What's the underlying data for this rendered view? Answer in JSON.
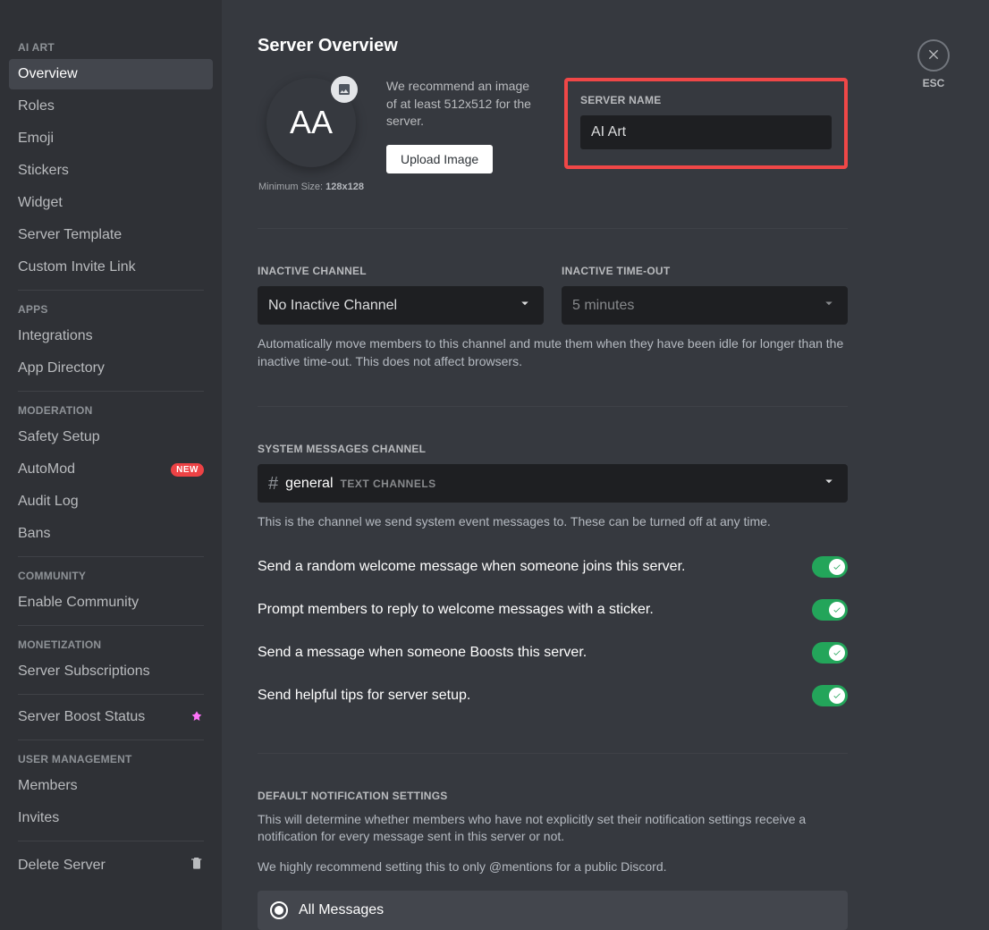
{
  "sidebar": {
    "sections": [
      {
        "header": "AI ART",
        "items": [
          {
            "label": "Overview",
            "active": true
          },
          {
            "label": "Roles"
          },
          {
            "label": "Emoji"
          },
          {
            "label": "Stickers"
          },
          {
            "label": "Widget"
          },
          {
            "label": "Server Template"
          },
          {
            "label": "Custom Invite Link"
          }
        ]
      },
      {
        "header": "APPS",
        "items": [
          {
            "label": "Integrations"
          },
          {
            "label": "App Directory"
          }
        ]
      },
      {
        "header": "MODERATION",
        "items": [
          {
            "label": "Safety Setup"
          },
          {
            "label": "AutoMod",
            "badge": "NEW"
          },
          {
            "label": "Audit Log"
          },
          {
            "label": "Bans"
          }
        ]
      },
      {
        "header": "COMMUNITY",
        "items": [
          {
            "label": "Enable Community"
          }
        ]
      },
      {
        "header": "MONETIZATION",
        "items": [
          {
            "label": "Server Subscriptions"
          }
        ]
      },
      {
        "header": "",
        "items": [
          {
            "label": "Server Boost Status",
            "boost": true
          }
        ]
      },
      {
        "header": "USER MANAGEMENT",
        "items": [
          {
            "label": "Members"
          },
          {
            "label": "Invites"
          }
        ]
      },
      {
        "header": "",
        "items": [
          {
            "label": "Delete Server",
            "trash": true
          }
        ]
      }
    ]
  },
  "main": {
    "title": "Server Overview",
    "avatar_initials": "AA",
    "min_size_label": "Minimum Size: ",
    "min_size_value": "128x128",
    "recommend_text": "We recommend an image of at least 512x512 for the server.",
    "upload_button": "Upload Image",
    "server_name_label": "SERVER NAME",
    "server_name_value": "AI Art",
    "inactive_channel_label": "INACTIVE CHANNEL",
    "inactive_channel_value": "No Inactive Channel",
    "inactive_timeout_label": "INACTIVE TIME-OUT",
    "inactive_timeout_value": "5 minutes",
    "inactive_help": "Automatically move members to this channel and mute them when they have been idle for longer than the inactive time-out. This does not affect browsers.",
    "system_messages_label": "SYSTEM MESSAGES CHANNEL",
    "system_channel_name": "general",
    "system_channel_category": "TEXT CHANNELS",
    "system_help": "This is the channel we send system event messages to. These can be turned off at any time.",
    "toggles": [
      {
        "label": "Send a random welcome message when someone joins this server.",
        "on": true
      },
      {
        "label": "Prompt members to reply to welcome messages with a sticker.",
        "on": true
      },
      {
        "label": "Send a message when someone Boosts this server.",
        "on": true
      },
      {
        "label": "Send helpful tips for server setup.",
        "on": true
      }
    ],
    "default_notif_label": "DEFAULT NOTIFICATION SETTINGS",
    "default_notif_help1": "This will determine whether members who have not explicitly set their notification settings receive a notification for every message sent in this server or not.",
    "default_notif_help2": "We highly recommend setting this to only @mentions for a public Discord.",
    "radio_all_messages": "All Messages"
  },
  "close": {
    "esc": "ESC"
  }
}
